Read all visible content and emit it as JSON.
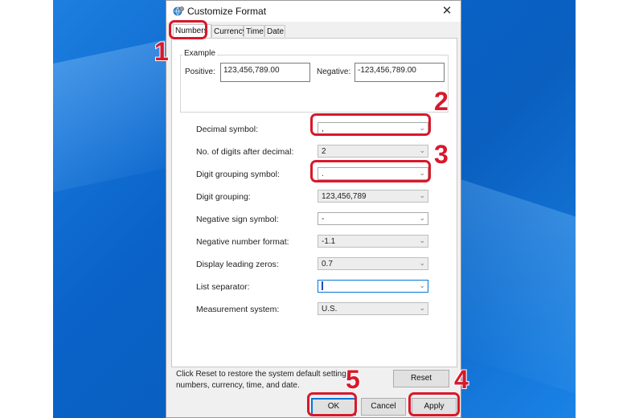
{
  "window": {
    "title": "Customize Format",
    "close_glyph": "✕",
    "icon": "globe-settings-icon"
  },
  "tabs": [
    {
      "label": "Numbers",
      "active": true
    },
    {
      "label": "Currency",
      "active": false
    },
    {
      "label": "Time",
      "active": false
    },
    {
      "label": "Date",
      "active": false
    }
  ],
  "example": {
    "legend": "Example",
    "positive_label": "Positive:",
    "positive_value": "123,456,789.00",
    "negative_label": "Negative:",
    "negative_value": "-123,456,789.00"
  },
  "settings": [
    {
      "label": "Decimal symbol:",
      "value": ",",
      "enabled": true
    },
    {
      "label": "No. of digits after decimal:",
      "value": "2",
      "enabled": false
    },
    {
      "label": "Digit grouping symbol:",
      "value": ".",
      "enabled": true
    },
    {
      "label": "Digit grouping:",
      "value": "123,456,789",
      "enabled": false
    },
    {
      "label": "Negative sign symbol:",
      "value": "-",
      "enabled": true
    },
    {
      "label": "Negative number format:",
      "value": "-1.1",
      "enabled": false
    },
    {
      "label": "Display leading zeros:",
      "value": "0.7",
      "enabled": false
    },
    {
      "label": "List separator:",
      "value": "",
      "enabled": true
    },
    {
      "label": "Measurement system:",
      "value": "U.S.",
      "enabled": false
    }
  ],
  "footer": {
    "reset_text_line1": "Click Reset to restore the system default settings",
    "reset_text_line2": "numbers, currency, time, and date.",
    "reset_button": "Reset",
    "ok_button": "OK",
    "cancel_button": "Cancel",
    "apply_button": "Apply"
  },
  "annotations": {
    "color": "#d8182b",
    "steps": [
      "1",
      "2",
      "3",
      "4",
      "5"
    ]
  }
}
